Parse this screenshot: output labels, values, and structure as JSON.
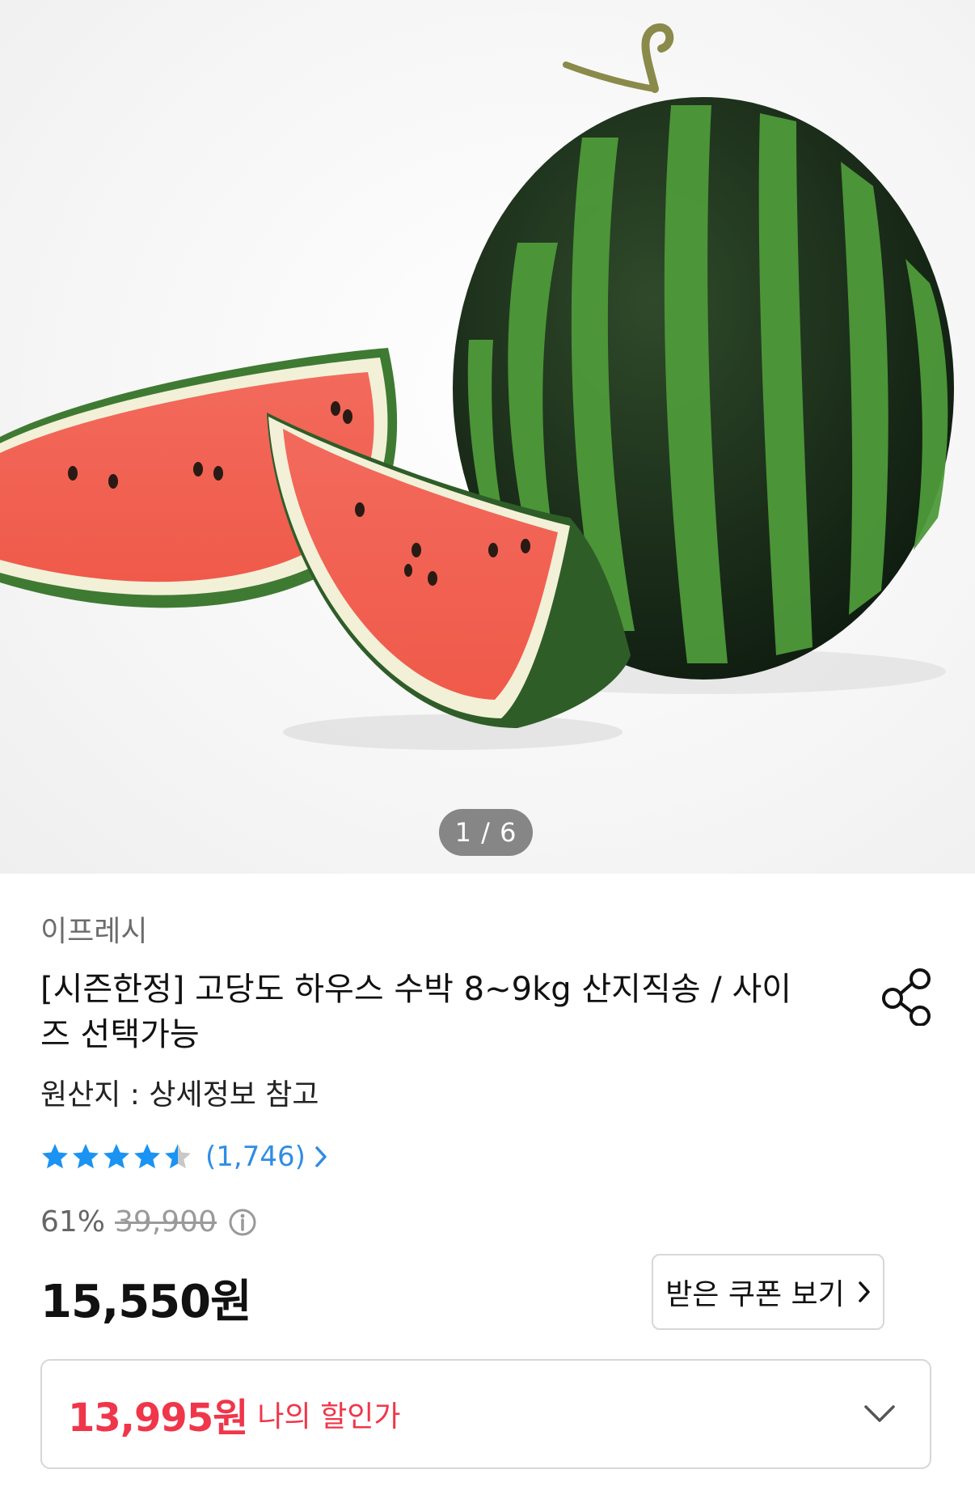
{
  "gallery": {
    "image_label": "watermelon-product-photo",
    "pager": "1 / 6"
  },
  "product": {
    "brand": "이프레시",
    "title": "[시즌한정] 고당도 하우스 수박 8~9kg 산지직송 / 사이즈 선택가능",
    "origin": "원산지 : 상세정보 참고",
    "rating": 4.5,
    "review_count": "(1,746)",
    "discount_rate": "61%",
    "original_price": "39,900",
    "price": "15,550원",
    "coupon_button": "받은 쿠폰 보기",
    "my_price": "13,995원",
    "my_price_label": "나의 할인가"
  },
  "icons": {
    "share": "share-icon",
    "info": "info-circle-icon",
    "chevron": "chevron-right-icon",
    "dropdown": "chevron-down-icon",
    "star": "star-icon"
  },
  "colors": {
    "star_filled": "#1a93f2",
    "star_empty": "#c8c8c8",
    "review_link": "#2f8de4",
    "my_price": "#f0364a"
  }
}
